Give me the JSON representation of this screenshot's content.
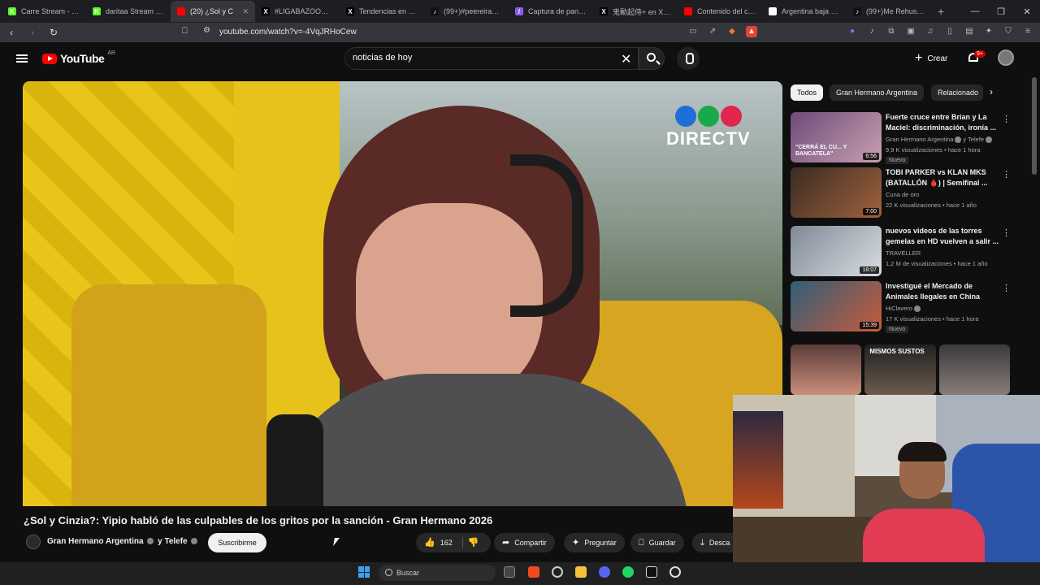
{
  "browser": {
    "tabs": [
      {
        "title": "Carre Stream - Watc",
        "favicon_color": "#53fc18",
        "favicon_letter": "K",
        "active": false
      },
      {
        "title": "daritaa Stream - Wa",
        "favicon_color": "#53fc18",
        "favicon_letter": "K",
        "active": false
      },
      {
        "title": "(20) ¿Sol y C",
        "favicon_color": "#ff0000",
        "favicon_letter": "",
        "active": true
      },
      {
        "title": "#LIGABAZOOKA en",
        "favicon_color": "#000000",
        "favicon_letter": "X",
        "active": false
      },
      {
        "title": "Tendencias en X: \"5",
        "favicon_color": "#000000",
        "favicon_letter": "X",
        "active": false
      },
      {
        "title": "(99+)#peereira7 | p",
        "favicon_color": "#111111",
        "favicon_letter": "♪",
        "active": false
      },
      {
        "title": "Captura de pantalla",
        "favicon_color": "#8a5cf6",
        "favicon_letter": "/",
        "active": false
      },
      {
        "title": "鬼動起侍+ en X: \"2",
        "favicon_color": "#000000",
        "favicon_letter": "X",
        "active": false
      },
      {
        "title": "Contenido del canal",
        "favicon_color": "#ff0000",
        "favicon_letter": "",
        "active": false
      },
      {
        "title": "Argentina baja de 1",
        "favicon_color": "#ffffff",
        "favicon_letter": "E",
        "active": false
      },
      {
        "title": "(99+)Me Rehuso de",
        "favicon_color": "#111111",
        "favicon_letter": "♪",
        "active": false
      }
    ],
    "new_tab": "+",
    "url": "youtube.com/watch?v=-4VqJRHoCew"
  },
  "youtube": {
    "logo_text": "YouTube",
    "country": "AR",
    "search_value": "noticias de hoy",
    "create_label": "Crear",
    "notif_count": "9+"
  },
  "video": {
    "overlay_brand": "DIRECTV",
    "title": "¿Sol y Cinzia?: Yipio habló de las culpables de los gritos por la sanción - Gran Hermano 2026",
    "channel": "Gran Hermano Argentina",
    "channel_suffix": "y Telefe",
    "subscribe_label": "Suscribirme",
    "likes": "162",
    "share_label": "Compartir",
    "ask_label": "Preguntar",
    "save_label": "Guardar",
    "download_label": "Desca"
  },
  "chips": [
    {
      "label": "Todos",
      "active": true
    },
    {
      "label": "Gran Hermano Argentina",
      "active": false
    },
    {
      "label": "Relacionado",
      "active": false
    }
  ],
  "recommendations": [
    {
      "title": "Fuerte cruce entre Brian y La Maciel: discriminación, ironía ...",
      "channel": "Gran Hermano Argentina",
      "channel_suffix": "y Telefe",
      "meta": "9,9 K visualizaciones • hace 1 hora",
      "badge": "Nuevo",
      "duration": "6:56",
      "thumb_caption": "\"CERRÁ EL CU... Y BANCATELA\"",
      "colors": [
        "#6d4a7a",
        "#c8a0b0"
      ]
    },
    {
      "title": "TOBI PARKER vs KLAN MKS (BATALLÓN 🩸) | Semifinal ...",
      "channel": "Cuna de oro",
      "channel_suffix": "",
      "meta": "22 K visualizaciones • hace 1 año",
      "badge": "",
      "duration": "7:00",
      "thumb_caption": "",
      "colors": [
        "#3a2b24",
        "#a0623c"
      ]
    },
    {
      "title": "nuevos videos de las torres gemelas en HD vuelven a salir ...",
      "channel": "TRAVELLER",
      "channel_suffix": "",
      "meta": "1,2 M de visualizaciones • hace 1 año",
      "badge": "",
      "duration": "18:07",
      "thumb_caption": "",
      "colors": [
        "#7f8a96",
        "#d8dde2"
      ]
    },
    {
      "title": "Investigué el Mercado de Animales Ilegales en China",
      "channel": "HiClavero",
      "channel_suffix": "",
      "meta": "17 K visualizaciones • hace 1 hora",
      "badge": "Nuevo",
      "duration": "15:39",
      "thumb_caption": "",
      "colors": [
        "#2f5e78",
        "#c85a3a"
      ]
    }
  ],
  "shorts_caption": "MISMOS SUSTOS",
  "taskbar": {
    "search_placeholder": "Buscar"
  }
}
